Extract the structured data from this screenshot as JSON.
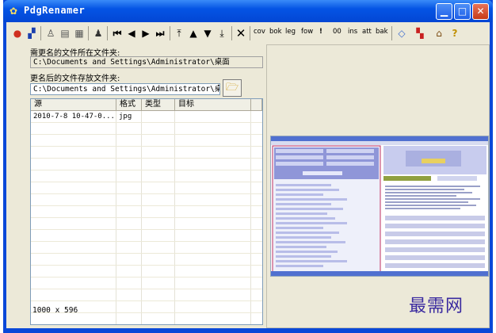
{
  "window": {
    "title": "PdgRenamer",
    "app_icon": "app-icon"
  },
  "title_buttons": [
    "minimize",
    "maximize",
    "close"
  ],
  "toolbar": {
    "icons_left": [
      "color-icon",
      "image-icon",
      "person-icon",
      "book-icon",
      "grid-icon",
      "people-icon"
    ],
    "nav": [
      "first-icon",
      "prev-icon",
      "next-icon",
      "last-icon"
    ],
    "order": [
      "top-icon",
      "up-icon",
      "down-icon",
      "bottom-icon"
    ],
    "close_icon": "x-icon",
    "text_buttons": [
      "cov",
      "bok",
      "leg",
      "fow",
      "!",
      "00",
      "ins",
      "att",
      "bak"
    ],
    "icons_right": [
      "eraser-icon",
      "chart-icon",
      "home-icon",
      "help-icon"
    ]
  },
  "source_folder": {
    "label": "需更名的文件所在文件夹:",
    "value": "C:\\Documents and Settings\\Administrator\\桌面"
  },
  "target_folder": {
    "label": "更名后的文件存放文件夹:",
    "value": "C:\\Documents and Settings\\Administrator\\桌面_new"
  },
  "table": {
    "columns": [
      "源",
      "格式",
      "类型",
      "目标"
    ],
    "rows": [
      {
        "source": "2010-7-8 10-47-0...",
        "format": "jpg",
        "type": "",
        "target": ""
      }
    ]
  },
  "status": {
    "size": "1000 x 596"
  },
  "watermark": "最需网",
  "colors": {
    "title_bar": "#0454e4",
    "client": "#ece9d8",
    "watermark": "#3a2aa0"
  }
}
